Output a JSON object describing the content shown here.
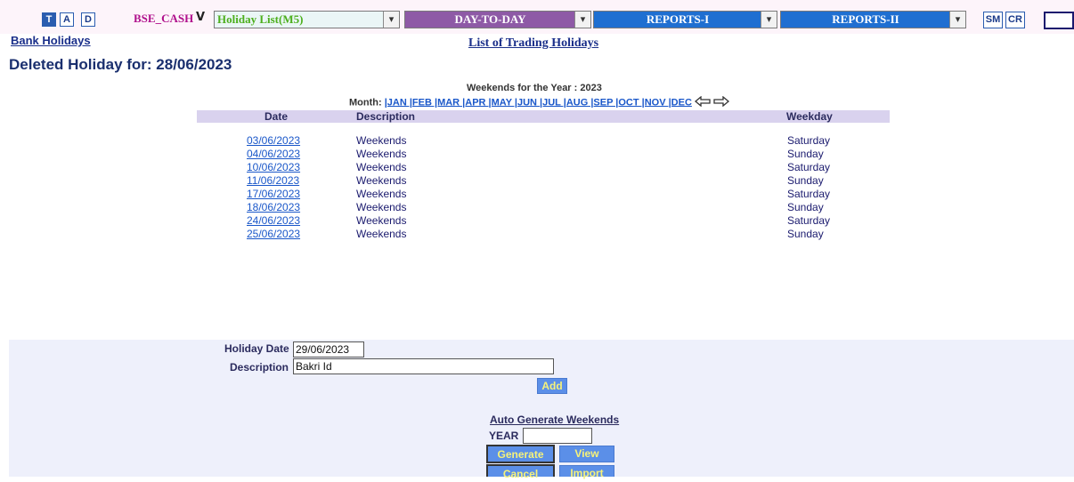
{
  "toolbar": {
    "t_label": "T",
    "a_label": "A",
    "d_label": "D",
    "exchange": "BSE_CASH",
    "menu1": "Holiday List(M5)",
    "menu2": "DAY-TO-DAY",
    "menu3": "REPORTS-I",
    "menu4": "REPORTS-II",
    "sm_label": "SM",
    "cr_label": "CR",
    "chevron": "⌄",
    "colors": {
      "exchange_text": "#b0108c",
      "menu1_text": "#4caf1d",
      "menu2_bg": "#8e5aa6",
      "report_bg": "#1f6fd1"
    }
  },
  "links": {
    "bank_holidays": "Bank Holidays",
    "list_title": "List of Trading Holidays"
  },
  "status": {
    "deleted": "Deleted Holiday for: 28/06/2023"
  },
  "weekends": {
    "title": "Weekends for the Year : 2023",
    "month_label": "Month:",
    "months": "|JAN |FEB |MAR |APR |MAY |JUN |JUL |AUG |SEP |OCT |NOV |DEC",
    "prev_icon": "arrow-left-icon",
    "next_icon": "arrow-right-icon"
  },
  "table": {
    "headers": [
      "Date",
      "Description",
      "Weekday"
    ],
    "rows": [
      [
        "03/06/2023",
        "Weekends",
        "Saturday"
      ],
      [
        "04/06/2023",
        "Weekends",
        "Sunday"
      ],
      [
        "10/06/2023",
        "Weekends",
        "Saturday"
      ],
      [
        "11/06/2023",
        "Weekends",
        "Sunday"
      ],
      [
        "17/06/2023",
        "Weekends",
        "Saturday"
      ],
      [
        "18/06/2023",
        "Weekends",
        "Sunday"
      ],
      [
        "24/06/2023",
        "Weekends",
        "Saturday"
      ],
      [
        "25/06/2023",
        "Weekends",
        "Sunday"
      ]
    ]
  },
  "form": {
    "holiday_date_label": "Holiday Date",
    "holiday_date_value": "29/06/2023",
    "description_label": "Description",
    "description_value": "Bakri Id",
    "add_label": "Add",
    "auto_title": "Auto Generate Weekends",
    "year_label": "YEAR",
    "year_value": "",
    "generate_label": "Generate",
    "view_label": "View",
    "cancel_label": "Cancel",
    "import_label": "Import"
  }
}
